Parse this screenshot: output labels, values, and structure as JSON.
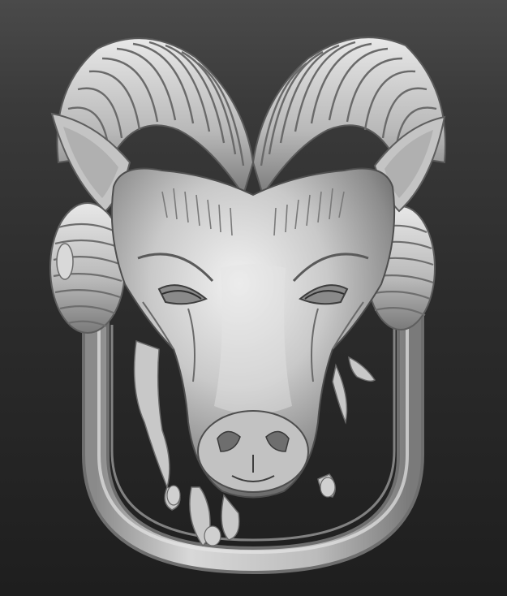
{
  "scene": {
    "subject_icon": "ram-head-sculpt",
    "background_top_color": "#4a4a4a",
    "background_bottom_color": "#1e1e1e",
    "material_color": "#bdbdbd"
  }
}
